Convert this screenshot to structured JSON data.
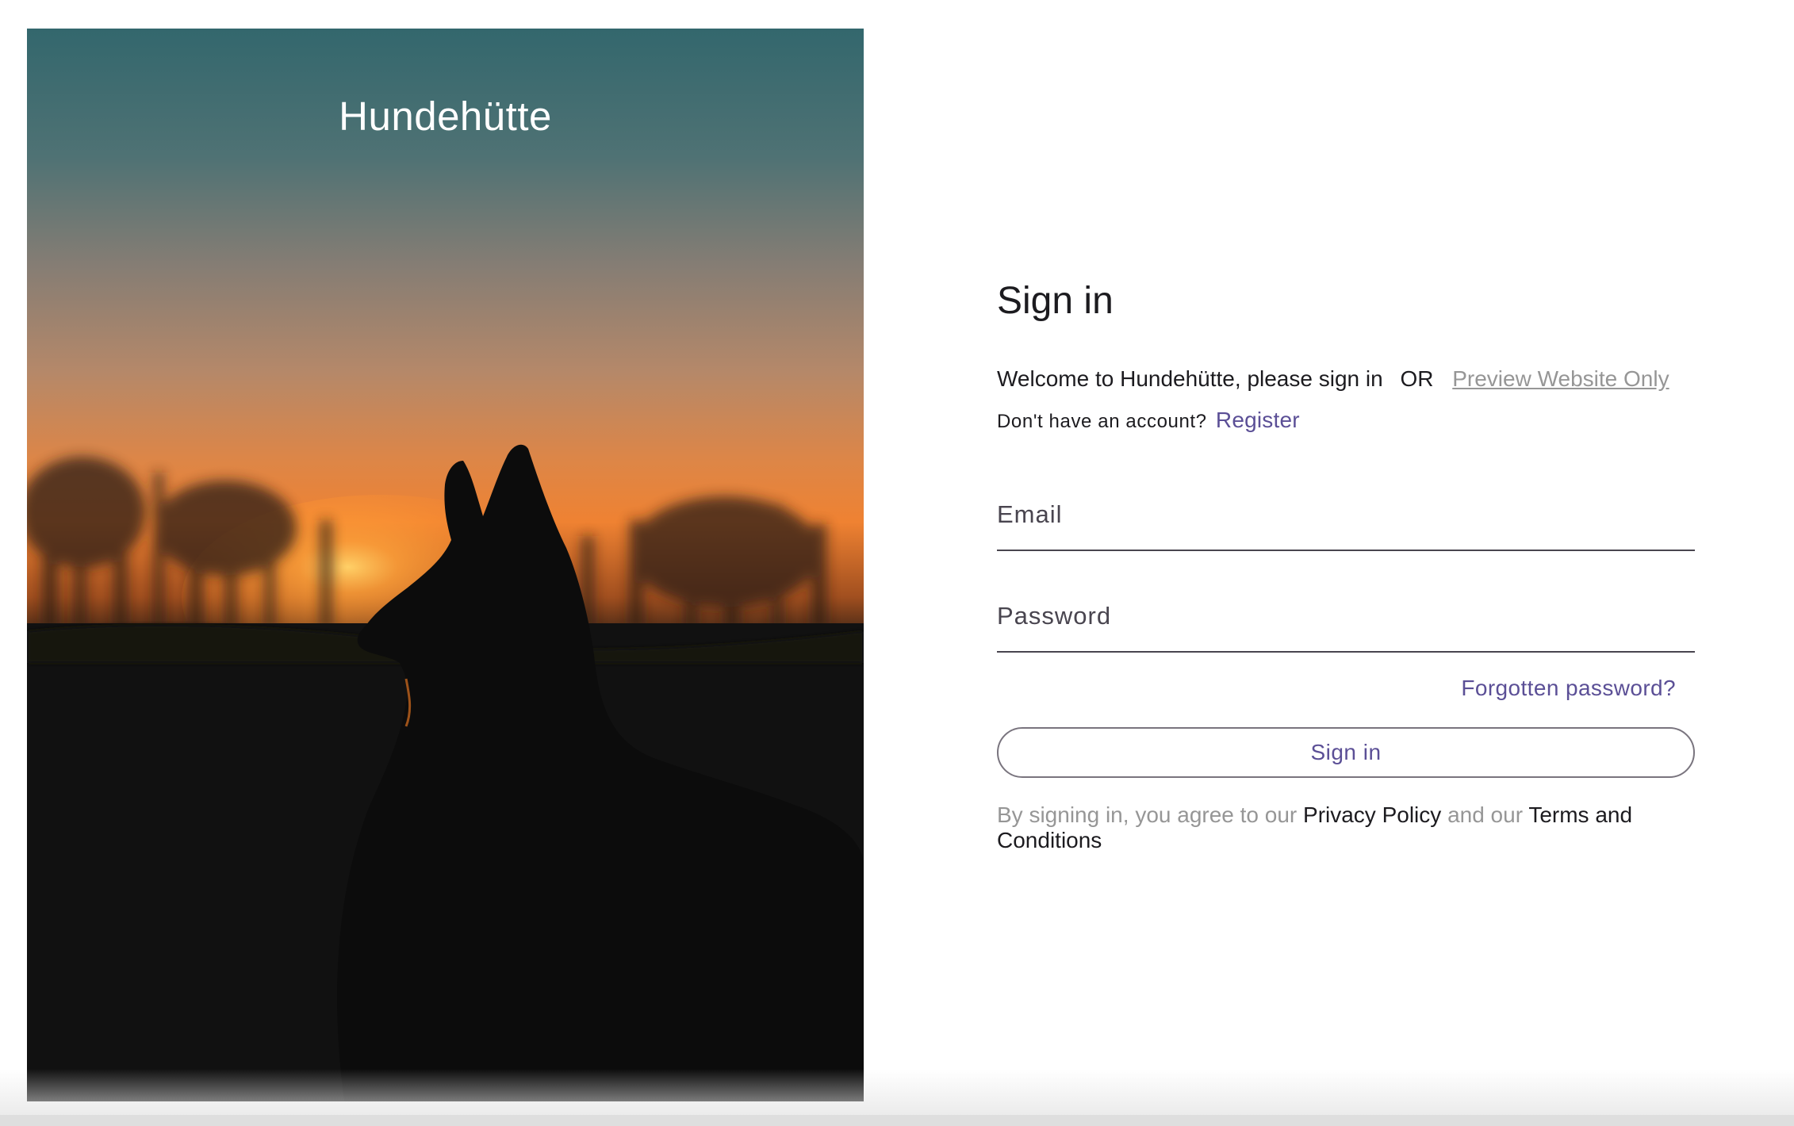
{
  "brand": {
    "name": "Hundehütte"
  },
  "hero": {
    "image_icon": "dog-silhouette-sunset-photo"
  },
  "signin": {
    "title": "Sign in",
    "welcome_text": "Welcome to Hundehütte, please sign in",
    "or_text": "OR",
    "preview_link": "Preview Website Only",
    "no_account_text": "Don't have an account?",
    "register_link": "Register",
    "email": {
      "label": "Email",
      "value": ""
    },
    "password": {
      "label": "Password",
      "value": ""
    },
    "forgot_link": "Forgotten password?",
    "submit_label": "Sign in",
    "terms": {
      "prefix": "By signing in, you agree to our",
      "privacy_link": "Privacy Policy",
      "middle": "and our",
      "terms_link": "Terms and Conditions"
    }
  },
  "colors": {
    "accent": "#5b4f96",
    "muted_text": "#969696",
    "field_line": "#49454f",
    "button_border": "#79747e"
  }
}
